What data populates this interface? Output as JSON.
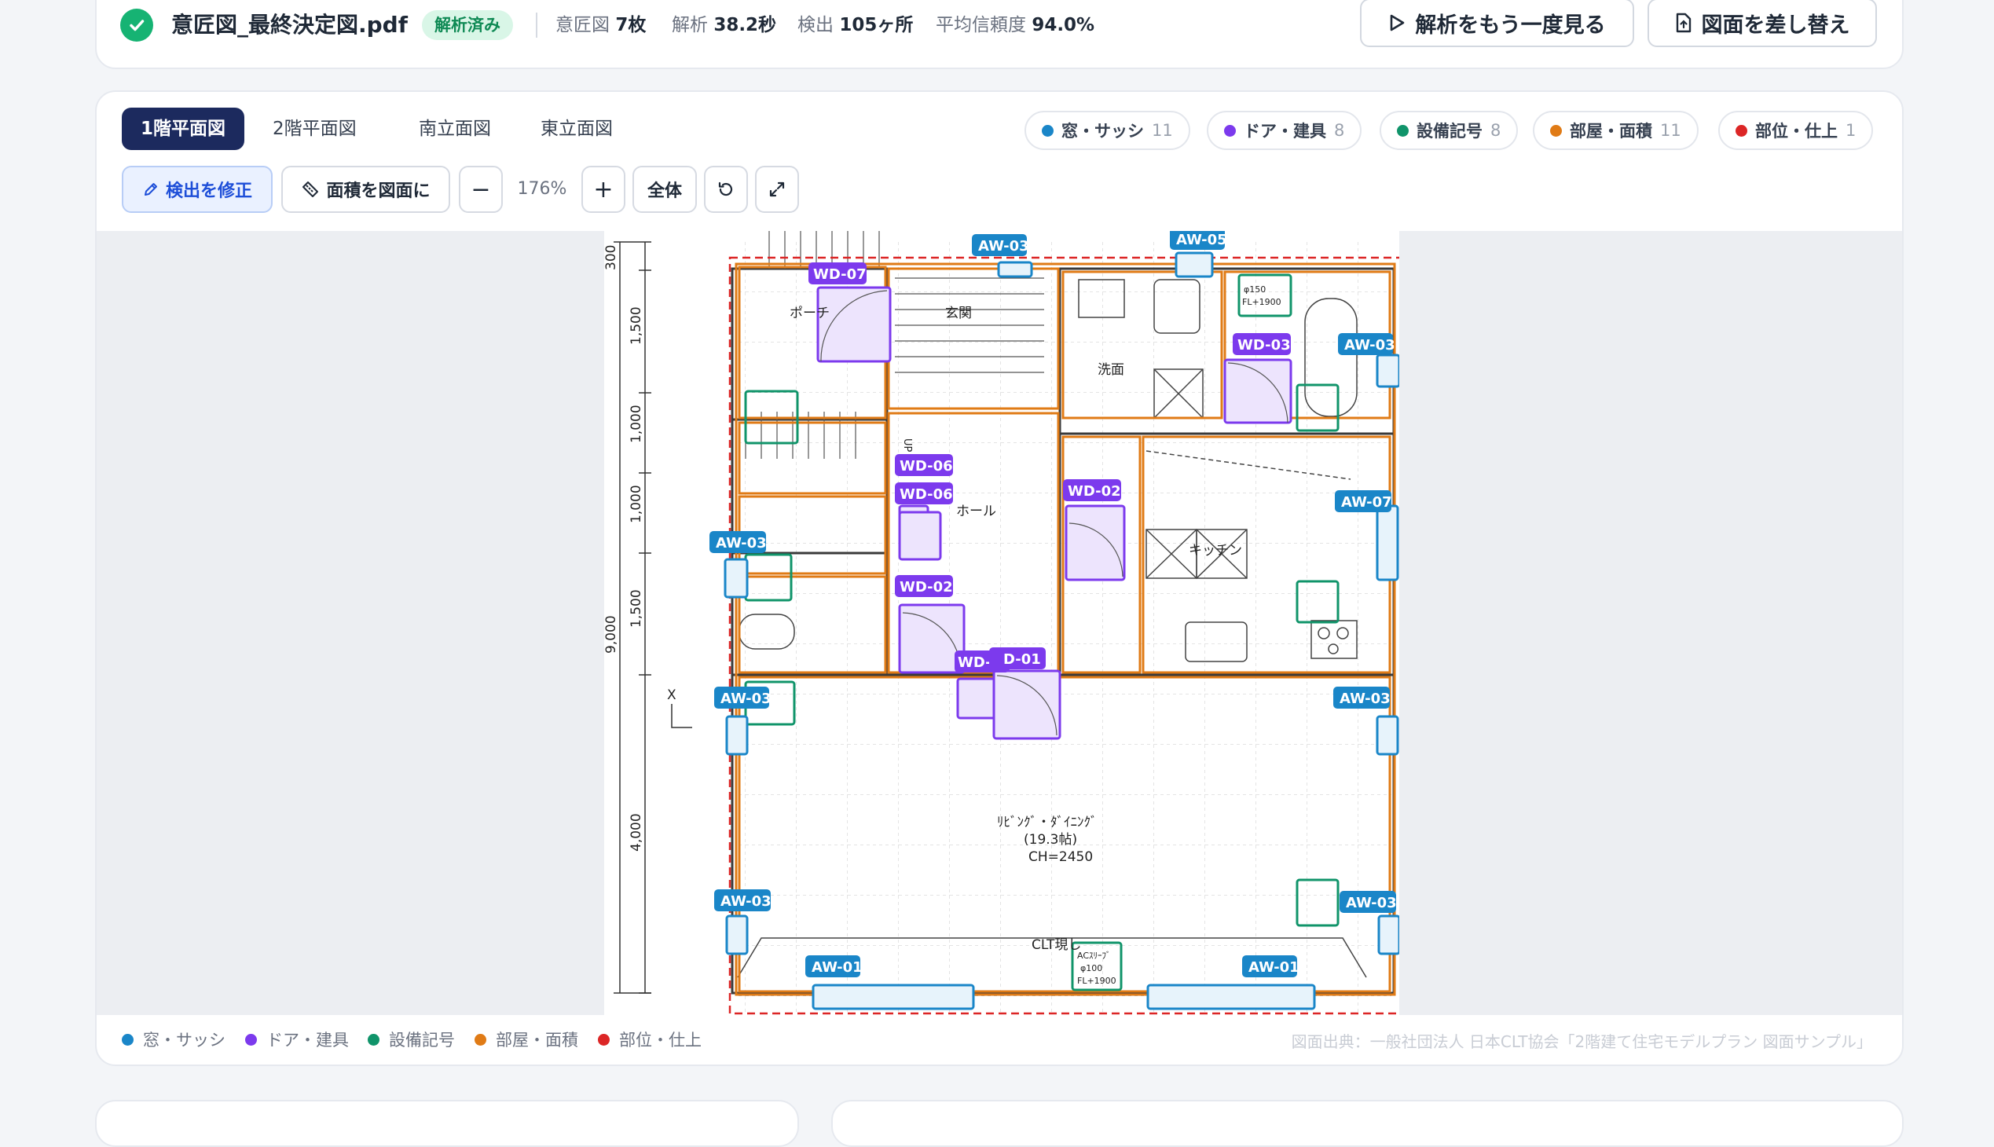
{
  "file": {
    "name": "意匠図_最終決定図.pdf",
    "status": "解析済み",
    "stats": [
      {
        "label": "意匠図",
        "value": "7枚"
      },
      {
        "label": "解析",
        "value": "38.2秒"
      },
      {
        "label": "検出",
        "value": "105ヶ所"
      },
      {
        "label": "平均信頼度",
        "value": "94.0%"
      }
    ],
    "actions": {
      "replay": "解析をもう一度見る",
      "replace": "図面を差し替え"
    }
  },
  "tabs": [
    {
      "label": "1階平面図",
      "active": true
    },
    {
      "label": "2階平面図",
      "active": false
    },
    {
      "label": "南立面図",
      "active": false
    },
    {
      "label": "東立面図",
      "active": false
    }
  ],
  "filters": [
    {
      "label": "窓・サッシ",
      "count": "11",
      "color": "#1a86c8"
    },
    {
      "label": "ドア・建具",
      "count": "8",
      "color": "#7c3aed"
    },
    {
      "label": "設備記号",
      "count": "8",
      "color": "#10946a"
    },
    {
      "label": "部屋・面積",
      "count": "11",
      "color": "#e07b16"
    },
    {
      "label": "部位・仕上",
      "count": "1",
      "color": "#dc2626"
    }
  ],
  "toolbar": {
    "edit_detection": "検出を修正",
    "area_to_plan": "面積を図面に",
    "zoom_out": "−",
    "zoom": "176%",
    "zoom_in": "+",
    "fit": "全体"
  },
  "plan": {
    "dimensions": {
      "d300": "300",
      "d1500a": "1,500",
      "d1000a": "1,000",
      "d1000b": "1,000",
      "d1500b": "1,500",
      "d4000": "4,000",
      "total": "9,000"
    },
    "axis_mark": "X",
    "rooms": {
      "porch": "ポーチ",
      "entrance": "玄関",
      "washroom": "洗面",
      "hall": "ホール",
      "kitchen": "キッチン",
      "living_1": "ﾘﾋﾞﾝｸﾞ・ﾀﾞｲﾆﾝｸﾞ",
      "living_2": "(19.3帖)",
      "living_3": "CH=2450",
      "clt": "CLT現し",
      "up": "UP"
    },
    "equipment_notes": {
      "vent_150": "φ150",
      "fl_1900": "FL+1900",
      "ac_1": "ACｽﾘｰﾌﾞ",
      "ac_2": "φ100",
      "ac_3": "FL+1900"
    },
    "tags": {
      "aw01": "AW-01",
      "aw03": "AW-03",
      "aw05": "AW-05",
      "aw07": "AW-07",
      "wd02": "WD-02",
      "wd04": "WD-04",
      "wd06": "WD-06",
      "wd07": "WD-07",
      "wd03": "WD-03",
      "d01": "D-01"
    }
  },
  "legend": [
    {
      "label": "窓・サッシ",
      "color": "#1a86c8"
    },
    {
      "label": "ドア・建具",
      "color": "#7c3aed"
    },
    {
      "label": "設備記号",
      "color": "#10946a"
    },
    {
      "label": "部屋・面積",
      "color": "#e07b16"
    },
    {
      "label": "部位・仕上",
      "color": "#dc2626"
    }
  ],
  "source": "図面出典：一般社団法人 日本CLT協会「2階建て住宅モデルプラン 図面サンプル」"
}
